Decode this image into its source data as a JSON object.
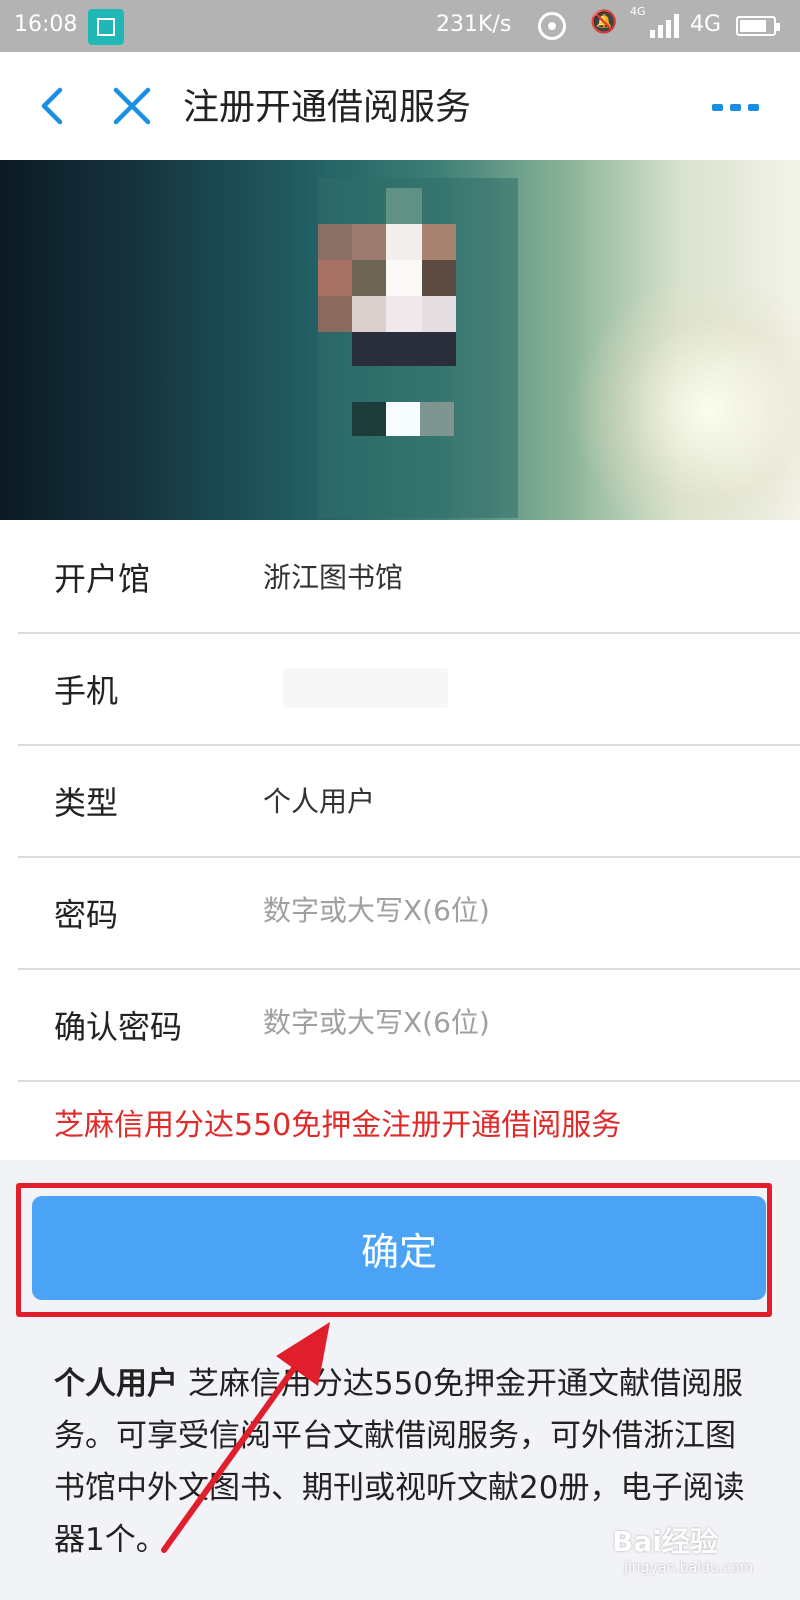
{
  "status_bar": {
    "time": "16:08",
    "speed": "231K/s",
    "network_small": "4G",
    "network": "4G"
  },
  "nav": {
    "title": "注册开通借阅服务"
  },
  "form": {
    "rows": [
      {
        "label": "开户馆",
        "value": "浙江图书馆"
      },
      {
        "label": "手机",
        "value": ""
      },
      {
        "label": "类型",
        "value": "个人用户"
      },
      {
        "label": "密码",
        "value": "",
        "placeholder": "数字或大写X(6位)"
      },
      {
        "label": "确认密码",
        "value": "",
        "placeholder": "数字或大写X(6位)"
      }
    ],
    "notice": "芝麻信用分达550免押金注册开通借阅服务"
  },
  "confirm_button": {
    "label": "确定"
  },
  "description": {
    "bold": "个人用户",
    "text": " 芝麻信用分达550免押金开通文献借阅服务。可享受信阅平台文献借阅服务，可外借浙江图书馆中外文图书、期刊或视听文献20册，电子阅读器1个。"
  },
  "watermark": {
    "main": "Bai经验",
    "sub": "jingyan.baidu.com"
  },
  "colors": {
    "accent": "#1a8fe3",
    "button": "#4aa3f5",
    "notice": "#e02b2b",
    "highlight_box": "#e01e2c"
  }
}
